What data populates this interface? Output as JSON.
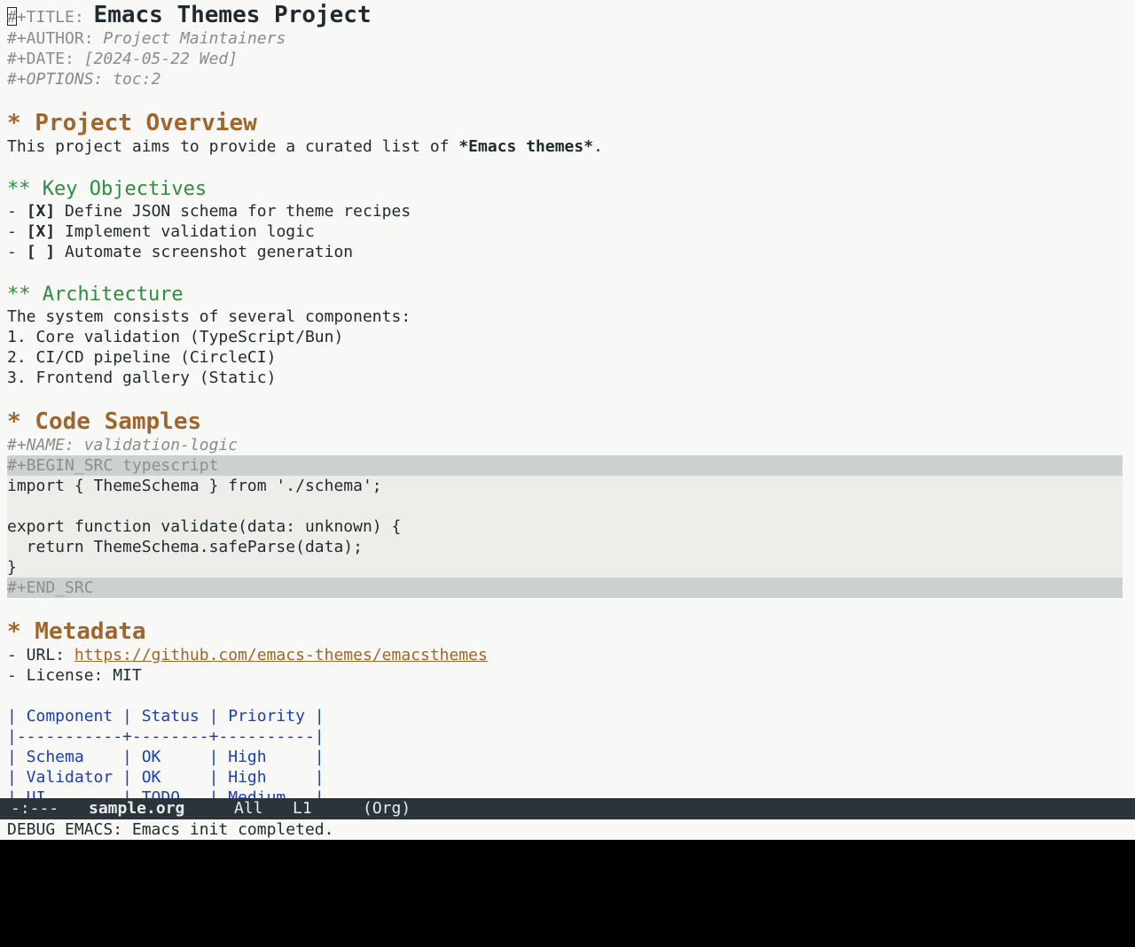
{
  "buffer": {
    "title_key": "#+TITLE:",
    "title_value": "Emacs Themes Project",
    "author_key": "#+AUTHOR:",
    "author_value": "Project Maintainers",
    "date_key": "#+DATE:",
    "date_value": "[2024-05-22 Wed]",
    "options_key": "#+OPTIONS:",
    "options_value": "toc:2",
    "h_overview": "* Project Overview",
    "overview_pre": "This project aims to provide a curated list of ",
    "overview_bold": "*Emacs themes*",
    "overview_post": ".",
    "h_objectives": "** Key Objectives",
    "objectives": [
      {
        "prefix": "- ",
        "box": "[X]",
        "text": " Define JSON schema for theme recipes"
      },
      {
        "prefix": "- ",
        "box": "[X]",
        "text": " Implement validation logic"
      },
      {
        "prefix": "- ",
        "box": "[ ]",
        "text": " Automate screenshot generation"
      }
    ],
    "h_architecture": "** Architecture",
    "architecture_intro": "The system consists of several components:",
    "architecture_items": [
      "1. Core validation (TypeScript/Bun)",
      "2. CI/CD pipeline (CircleCI)",
      "3. Frontend gallery (Static)"
    ],
    "h_code": "* Code Samples",
    "name_key": "#+NAME:",
    "name_value": "validation-logic",
    "begin_src_key": "#+BEGIN_SRC",
    "begin_src_lang": "typescript",
    "code_lines": [
      "import { ThemeSchema } from './schema';",
      "",
      "export function validate(data: unknown) {",
      "  return ThemeSchema.safeParse(data);",
      "}"
    ],
    "end_src": "#+END_SRC",
    "h_metadata": "* Metadata",
    "url_label": "- URL: ",
    "url_value": "https://github.com/emacs-themes/emacsthemes",
    "license_line": "- License: MIT",
    "table_lines": [
      "| Component | Status | Priority |",
      "|-----------+--------+----------|",
      "| Schema    | OK     | High     |",
      "| Validator | OK     | High     |",
      "| UI        | TODO   | Medium   |"
    ]
  },
  "modeline": {
    "status": "-:---",
    "buffer_name": "sample.org",
    "position": "All",
    "line": "L1",
    "mode": "(Org)"
  },
  "echo_area": "DEBUG EMACS: Emacs init completed.",
  "colors": {
    "background": "#f8f8f6",
    "heading1": "#a0652a",
    "heading2": "#2e8b3f",
    "table": "#1a3fb0",
    "modeline_bg": "#2a3439"
  }
}
